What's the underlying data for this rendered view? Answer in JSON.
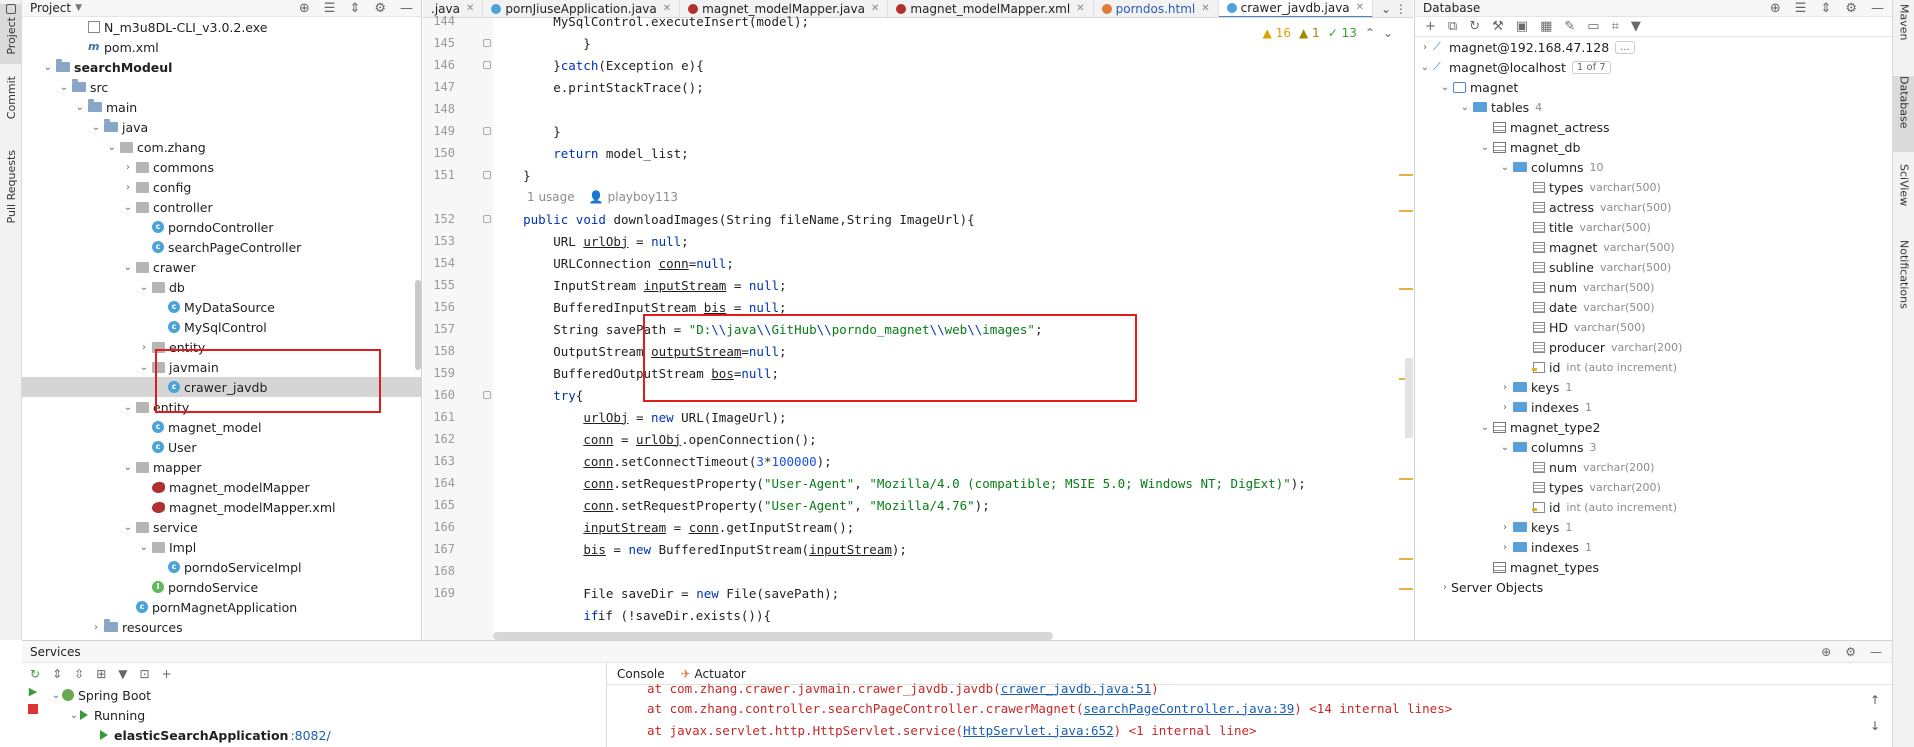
{
  "left_stripe": {
    "project": "Project",
    "commit": "Commit",
    "pull_requests": "Pull Requests"
  },
  "right_stripe": {
    "maven": "Maven",
    "database": "Database",
    "sciview": "SciView",
    "notifications": "Notifications"
  },
  "project": {
    "title": "Project",
    "tree": [
      {
        "label": "N_m3u8DL-CLI_v3.0.2.exe",
        "icon": "exe",
        "depth": 3
      },
      {
        "label": "pom.xml",
        "icon": "maven",
        "depth": 3
      },
      {
        "label": "searchModeul",
        "icon": "folder",
        "depth": 1,
        "bold": true
      },
      {
        "label": "src",
        "icon": "folder",
        "depth": 2
      },
      {
        "label": "main",
        "icon": "folder",
        "depth": 3
      },
      {
        "label": "java",
        "icon": "folder",
        "depth": 4
      },
      {
        "label": "com.zhang",
        "icon": "package",
        "depth": 5
      },
      {
        "label": "commons",
        "icon": "package",
        "depth": 6
      },
      {
        "label": "config",
        "icon": "package",
        "depth": 6
      },
      {
        "label": "controller",
        "icon": "package",
        "depth": 6
      },
      {
        "label": "porndoController",
        "icon": "class",
        "depth": 7
      },
      {
        "label": "searchPageController",
        "icon": "class",
        "depth": 7
      },
      {
        "label": "crawer",
        "icon": "package",
        "depth": 6
      },
      {
        "label": "db",
        "icon": "package",
        "depth": 7
      },
      {
        "label": "MyDataSource",
        "icon": "class",
        "depth": 8
      },
      {
        "label": "MySqlControl",
        "icon": "class",
        "depth": 8
      },
      {
        "label": "entity",
        "icon": "package",
        "depth": 7
      },
      {
        "label": "javmain",
        "icon": "package",
        "depth": 7
      },
      {
        "label": "crawer_javdb",
        "icon": "class",
        "depth": 8,
        "selected": true
      },
      {
        "label": "entity",
        "icon": "package",
        "depth": 6
      },
      {
        "label": "magnet_model",
        "icon": "class",
        "depth": 7
      },
      {
        "label": "User",
        "icon": "class",
        "depth": 7
      },
      {
        "label": "mapper",
        "icon": "package",
        "depth": 6
      },
      {
        "label": "magnet_modelMapper",
        "icon": "mybatis",
        "depth": 7
      },
      {
        "label": "magnet_modelMapper.xml",
        "icon": "mybatis",
        "depth": 7
      },
      {
        "label": "service",
        "icon": "package",
        "depth": 6
      },
      {
        "label": "Impl",
        "icon": "package",
        "depth": 7
      },
      {
        "label": "porndoServiceImpl",
        "icon": "class",
        "depth": 8
      },
      {
        "label": "porndoService",
        "icon": "interface",
        "depth": 7
      },
      {
        "label": "pornMagnetApplication",
        "icon": "class",
        "depth": 6
      },
      {
        "label": "resources",
        "icon": "folder",
        "depth": 4
      }
    ]
  },
  "editor": {
    "tabs": [
      {
        "label": ".java",
        "color": "#4aa3d9"
      },
      {
        "label": "pornJiuseApplication.java",
        "color": "#4aa3d9"
      },
      {
        "label": "magnet_modelMapper.java",
        "color": "#b12f2f"
      },
      {
        "label": "magnet_modelMapper.xml",
        "color": "#b12f2f"
      },
      {
        "label": "porndos.html",
        "color": "#e07b39"
      },
      {
        "label": "crawer_javdb.java",
        "color": "#4aa3d9",
        "active": true
      }
    ],
    "warnings": "16",
    "weak_warnings": "1",
    "checks": "13",
    "usage_hint": "1 usage",
    "author_hint": "playboy113",
    "lines": {
      "l144": "144",
      "l145": "145",
      "l146": "146",
      "l147": "147",
      "l148": "148",
      "l149": "149",
      "l150": "150",
      "l151": "151",
      "l152": "152",
      "l153": "153",
      "l154": "154",
      "l155": "155",
      "l156": "156",
      "l157": "157",
      "l158": "158",
      "l159": "159",
      "l160": "160",
      "l161": "161",
      "l162": "162",
      "l163": "163",
      "l164": "164",
      "l165": "165",
      "l166": "166",
      "l167": "167",
      "l168": "168",
      "l169": "169"
    },
    "code": {
      "c144": "        MySqlControl.executeInsert(model);",
      "c147": "        e.printStackTrace();",
      "c150a": "return",
      "c150b": " model_list;",
      "c152": "downloadImages(String fileName,String ImageUrl){",
      "c153a": "URL ",
      "c153b": "urlObj",
      "c154a": "URLConnection ",
      "c154b": "conn",
      "c155a": "InputStream ",
      "c155b": "inputStream",
      "c156a": "BufferedInputStream ",
      "c156b": "bis",
      "c157a": "String savePath = ",
      "c157s1": "\"D:",
      "c157e1": "\\\\",
      "c157s2": "java",
      "c157s3": "GitHub",
      "c157s4": "porndo_magnet",
      "c157s5": "web",
      "c157s6": "images\"",
      "c158a": "OutputStream ",
      "c158b": "outputStream",
      "c159a": "BufferedOutputStream ",
      "c159b": "bos",
      "c161b": " = ",
      "c161c": " URL(ImageUrl);",
      "c162c": ".openConnection();",
      "c163b": ".setConnectTimeout(",
      "c163n1": "3",
      "c163n2": "100000",
      "c164b": ".setRequestProperty(",
      "c164s1": "\"User-Agent\"",
      "c164s2": "\"Mozilla/4.0 (compatible; MSIE 5.0; Windows NT; DigExt)\"",
      "c165s2": "\"Mozilla/4.76\"",
      "c166c": ".getInputStream();",
      "c167c": " BufferedInputStream(",
      "c169a": "File saveDir = ",
      "c169b": " File(savePath);",
      "c170": "if (!saveDir.exists()){"
    }
  },
  "database": {
    "title": "Database",
    "tree": [
      {
        "label": "magnet@192.168.47.128",
        "badge": "...",
        "icon": "connection",
        "depth": 0
      },
      {
        "label": "magnet@localhost",
        "badge": "1 of 7",
        "icon": "connection",
        "depth": 0
      },
      {
        "label": "magnet",
        "icon": "schema",
        "depth": 1
      },
      {
        "label": "tables",
        "count": "4",
        "icon": "folder",
        "depth": 2
      },
      {
        "label": "magnet_actress",
        "icon": "table",
        "depth": 3
      },
      {
        "label": "magnet_db",
        "icon": "table",
        "depth": 3
      },
      {
        "label": "columns",
        "count": "10",
        "icon": "folder",
        "depth": 4
      },
      {
        "label": "types",
        "type": "varchar(500)",
        "icon": "column",
        "depth": 5
      },
      {
        "label": "actress",
        "type": "varchar(500)",
        "icon": "column",
        "depth": 5
      },
      {
        "label": "title",
        "type": "varchar(500)",
        "icon": "column",
        "depth": 5
      },
      {
        "label": "magnet",
        "type": "varchar(500)",
        "icon": "column",
        "depth": 5
      },
      {
        "label": "subline",
        "type": "varchar(500)",
        "icon": "column",
        "depth": 5
      },
      {
        "label": "num",
        "type": "varchar(500)",
        "icon": "column",
        "depth": 5
      },
      {
        "label": "date",
        "type": "varchar(500)",
        "icon": "column",
        "depth": 5
      },
      {
        "label": "HD",
        "type": "varchar(500)",
        "icon": "column",
        "depth": 5
      },
      {
        "label": "producer",
        "type": "varchar(200)",
        "icon": "column",
        "depth": 5
      },
      {
        "label": "id",
        "type": "int (auto increment)",
        "icon": "key",
        "depth": 5
      },
      {
        "label": "keys",
        "count": "1",
        "icon": "folder",
        "depth": 4
      },
      {
        "label": "indexes",
        "count": "1",
        "icon": "folder",
        "depth": 4
      },
      {
        "label": "magnet_type2",
        "icon": "table",
        "depth": 3
      },
      {
        "label": "columns",
        "count": "3",
        "icon": "folder",
        "depth": 4
      },
      {
        "label": "num",
        "type": "varchar(200)",
        "icon": "column",
        "depth": 5
      },
      {
        "label": "types",
        "type": "varchar(200)",
        "icon": "column",
        "depth": 5
      },
      {
        "label": "id",
        "type": "int (auto increment)",
        "icon": "key",
        "depth": 5
      },
      {
        "label": "keys",
        "count": "1",
        "icon": "folder",
        "depth": 4
      },
      {
        "label": "indexes",
        "count": "1",
        "icon": "folder",
        "depth": 4
      },
      {
        "label": "magnet_types",
        "icon": "table",
        "depth": 3
      },
      {
        "label": "Server Objects",
        "icon": "none",
        "depth": 1
      }
    ]
  },
  "services": {
    "title": "Services",
    "tree": [
      {
        "label": "Spring Boot",
        "depth": 0
      },
      {
        "label": "Running",
        "depth": 1
      },
      {
        "label": "elasticSearchApplication",
        "port": ":8082/",
        "depth": 2
      }
    ],
    "console_tab": "Console",
    "actuator_tab": "Actuator",
    "console": {
      "line1a": "at com.zhang.crawer.javmain.crawer_javdb.javdb(",
      "line1b": "crawer_javdb.java:51",
      "line1c": ")",
      "line2a": "at com.zhang.controller.searchPageController.crawerMagnet(",
      "line2b": "searchPageController.java:39",
      "line2c": ") <14 internal lines>",
      "line3a": "at javax.servlet.http.HttpServlet.service(",
      "line3b": "HttpServlet.java:652",
      "line3c": ") <1 internal line>"
    }
  },
  "colors": {
    "highlight_box": "#e21b1b",
    "keyword": "#0033b3",
    "string": "#067d17",
    "number": "#1750eb"
  }
}
